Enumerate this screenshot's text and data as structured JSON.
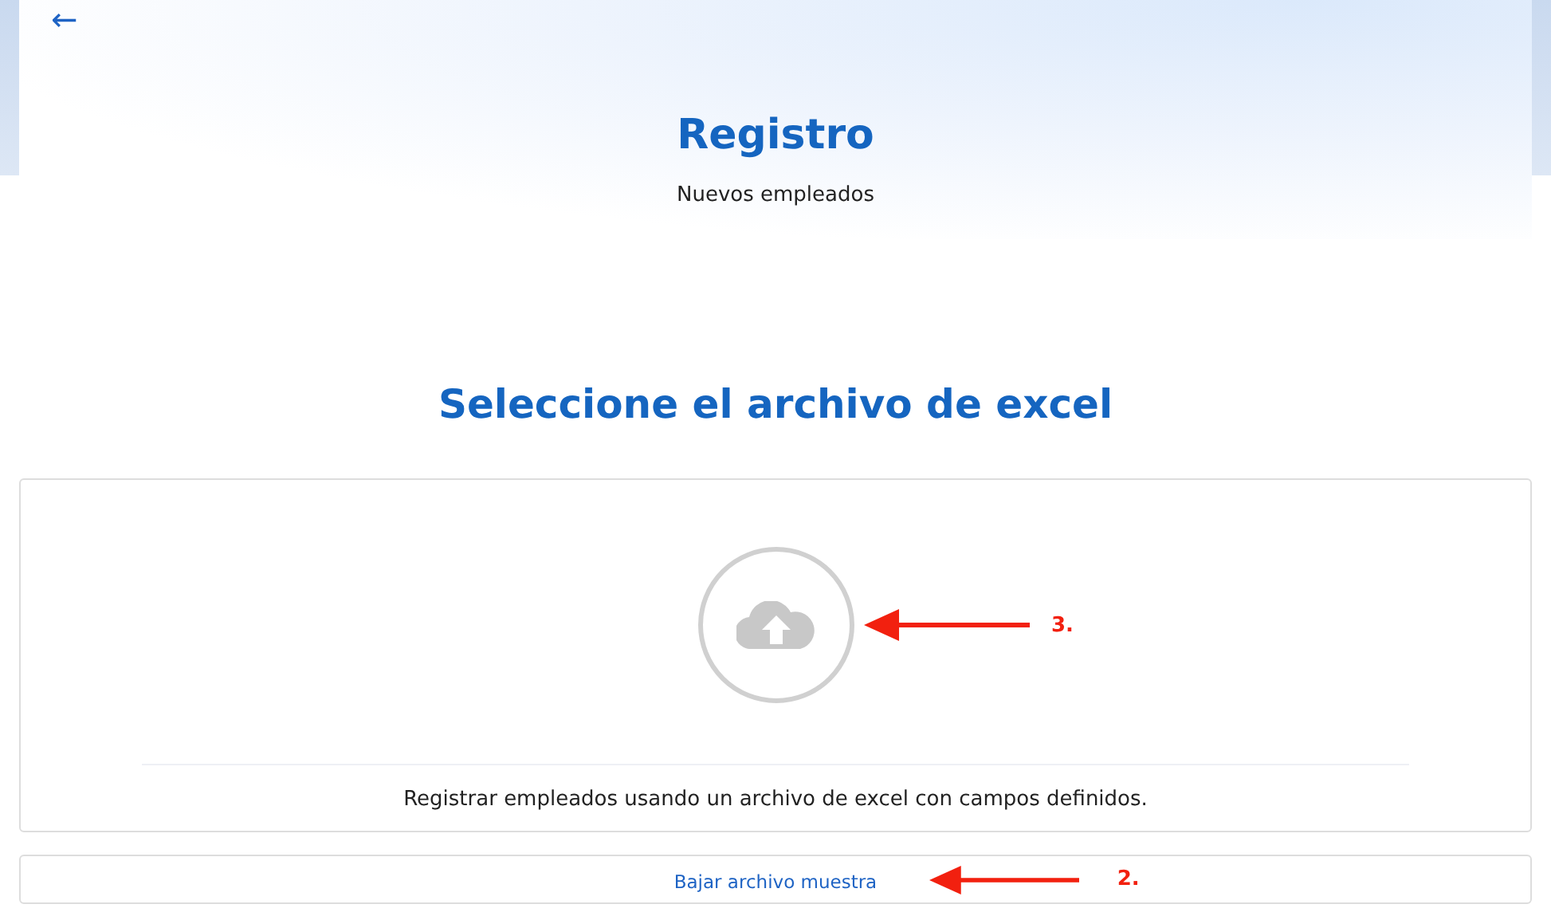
{
  "header": {
    "back": "←",
    "title": "Registro",
    "subtitle": "Nuevos empleados"
  },
  "upload": {
    "heading": "Seleccione el archivo de excel",
    "annotation": "3.",
    "description": "Registrar empleados usando un archivo de excel con campos definidos."
  },
  "sample": {
    "link": "Bajar archivo muestra",
    "annotation": "2."
  }
}
